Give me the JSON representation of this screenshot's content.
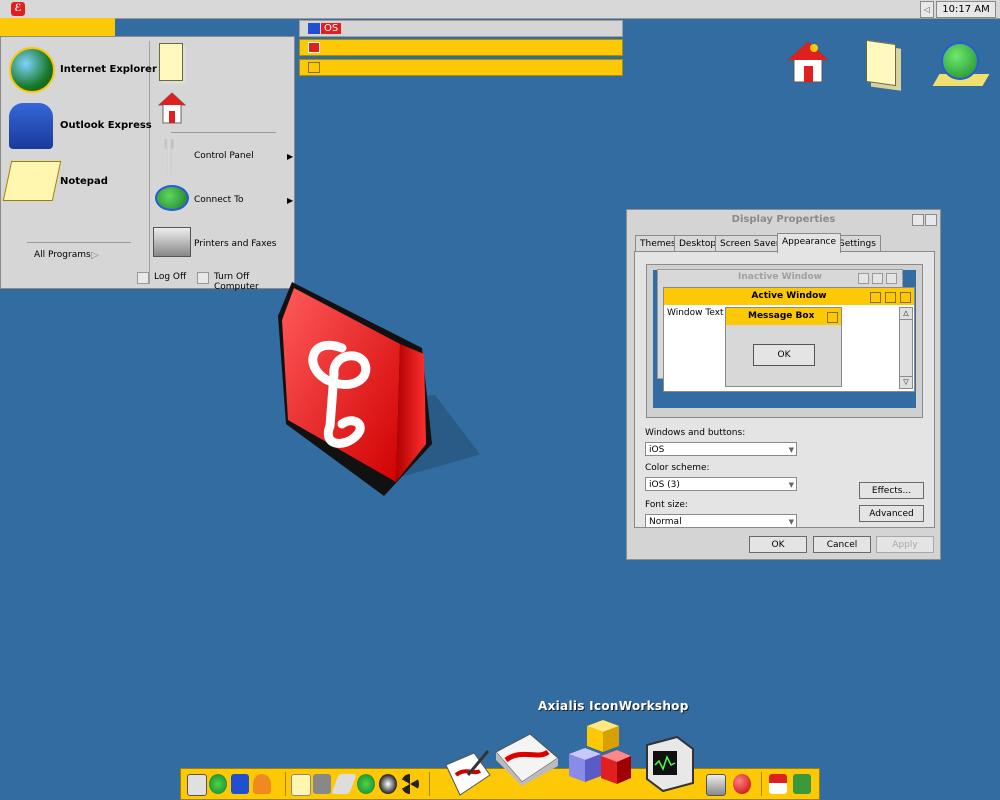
{
  "topbar": {
    "clock": "10:17 AM",
    "tray_arrow": "◁"
  },
  "taskbar": {
    "items": [
      {
        "label": "OS",
        "icon": "window-icon"
      },
      {
        "label": "",
        "icon": "os-logo-icon"
      },
      {
        "label": "",
        "icon": "yellow-window-icon"
      }
    ]
  },
  "start_menu": {
    "pinned": [
      {
        "label": "Internet Explorer",
        "icon": "globe-surfer-icon"
      },
      {
        "label": "Outlook Express",
        "icon": "mailbox-icon"
      },
      {
        "label": "Notepad",
        "icon": "notepad-icon"
      }
    ],
    "all_programs": "All Programs",
    "right": [
      {
        "label": "",
        "icon": "documents-folder-icon"
      },
      {
        "label": "",
        "icon": "home-icon"
      },
      {
        "label": "Control Panel",
        "icon": "wrench-icon",
        "submenu": true
      },
      {
        "label": "Connect To",
        "icon": "globe-network-icon",
        "submenu": true
      },
      {
        "label": "Printers and Faxes",
        "icon": "printer-icon"
      }
    ],
    "log_off": "Log Off",
    "turn_off": "Turn Off Computer"
  },
  "display_properties": {
    "title": "Display Properties",
    "tabs": [
      "Themes",
      "Desktop",
      "Screen Saver",
      "Appearance",
      "Settings"
    ],
    "active_tab": "Appearance",
    "preview": {
      "inactive_title": "Inactive Window",
      "active_title": "Active Window",
      "window_text": "Window Text",
      "message_box_title": "Message Box",
      "ok": "OK"
    },
    "windows_buttons_label": "Windows and buttons:",
    "windows_buttons_value": "iOS",
    "color_scheme_label": "Color scheme:",
    "color_scheme_value": "iOS (3)",
    "font_size_label": "Font size:",
    "font_size_value": "Normal",
    "effects_btn": "Effects...",
    "advanced_btn": "Advanced",
    "ok_btn": "OK",
    "cancel_btn": "Cancel",
    "apply_btn": "Apply"
  },
  "dock": {
    "label": "Axialis IconWorkshop"
  },
  "colors": {
    "desktop": "#326ca0",
    "accent_yellow": "#fdc805",
    "brand_red": "#e0201e"
  }
}
